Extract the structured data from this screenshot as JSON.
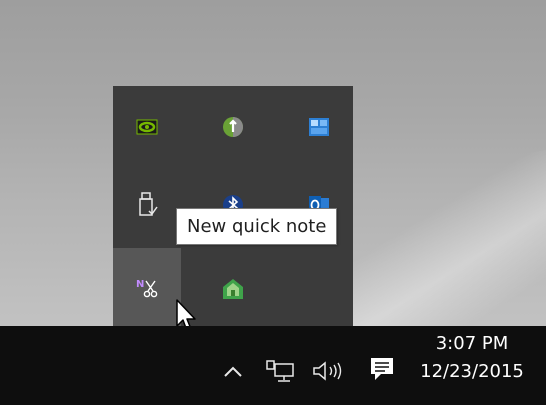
{
  "tooltip": {
    "text": "New quick note"
  },
  "tray_overflow": {
    "icons": [
      {
        "name": "nvidia-icon"
      },
      {
        "name": "globe-update-icon"
      },
      {
        "name": "tiles-app-icon"
      },
      {
        "name": "usb-eject-icon"
      },
      {
        "name": "bluetooth-icon"
      },
      {
        "name": "outlook-icon"
      },
      {
        "name": "onenote-clip-icon"
      },
      {
        "name": "home-app-icon"
      }
    ]
  },
  "taskbar": {
    "show_hidden_icons_glyph": "^",
    "clock": {
      "time": "3:07 PM",
      "date": "12/23/2015"
    }
  },
  "colors": {
    "taskbar": "#0e0e0e",
    "panel": "#3b3b3b",
    "hover": "#575757",
    "nvidia": "#76b900",
    "onenote": "#7b2f9e"
  }
}
